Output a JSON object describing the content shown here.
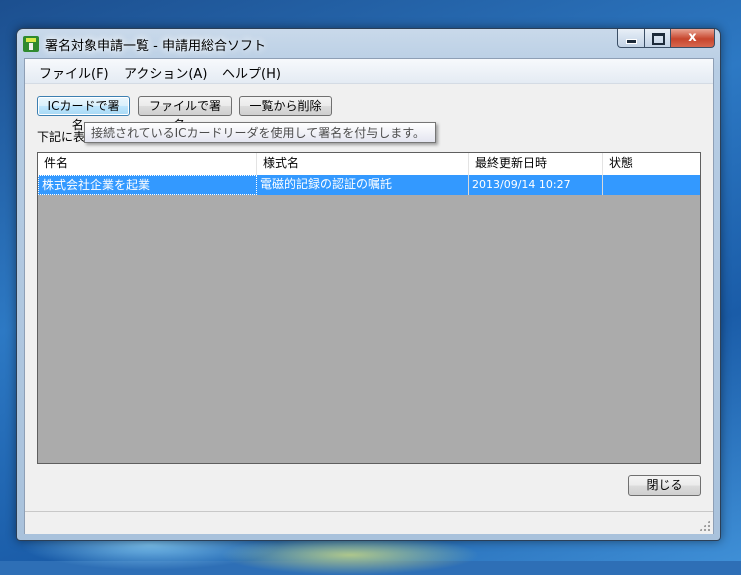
{
  "window": {
    "title": "署名対象申請一覧 - 申請用総合ソフト",
    "caption_buttons": {
      "close_glyph": "x"
    }
  },
  "menu": {
    "items": [
      {
        "label": "ファイル(F)"
      },
      {
        "label": "アクション(A)"
      },
      {
        "label": "ヘルプ(H)"
      }
    ]
  },
  "toolbar": {
    "ic_sign": "ICカードで署名...",
    "file_sign": "ファイルで署名...",
    "remove": "一覧から削除"
  },
  "caption_text": "下記に表",
  "tooltip": "接続されているICカードリーダを使用して署名を付与します。",
  "table": {
    "columns": [
      "件名",
      "様式名",
      "最終更新日時",
      "状態"
    ],
    "rows": [
      [
        "株式会社企業を起業",
        "電磁的記録の認証の嘱託",
        "2013/09/14 10:27",
        ""
      ]
    ]
  },
  "footer": {
    "close_label": "閉じる"
  },
  "colors": {
    "selection": "#3399ff",
    "list_background": "#ababab"
  }
}
